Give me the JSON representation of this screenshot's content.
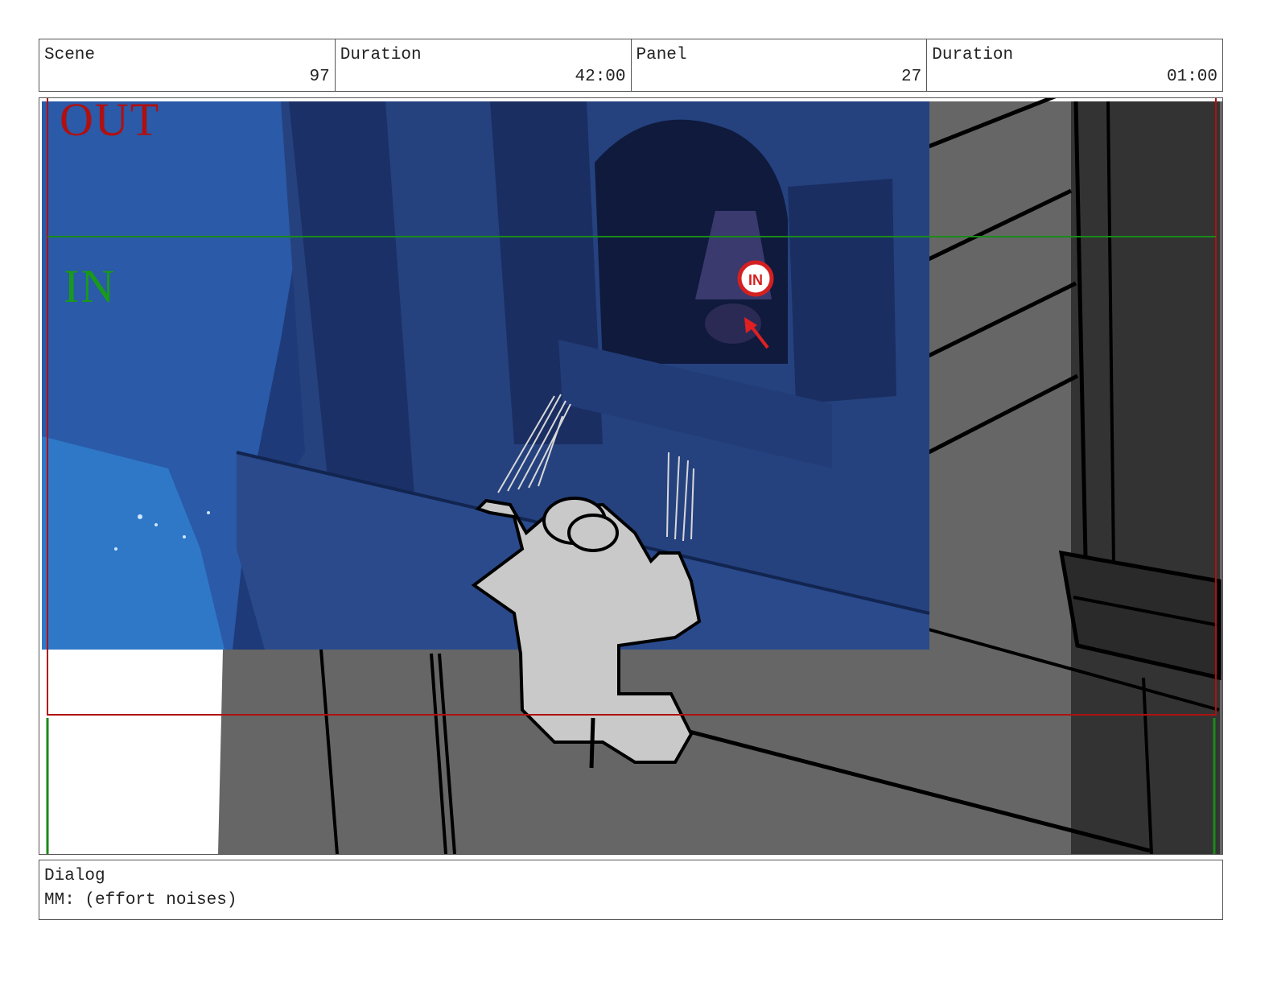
{
  "header": {
    "scene_label": "Scene",
    "scene_value": "97",
    "scene_duration_label": "Duration",
    "scene_duration_value": "42:00",
    "panel_label": "Panel",
    "panel_value": "27",
    "panel_duration_label": "Duration",
    "panel_duration_value": "01:00"
  },
  "panel": {
    "frame_out_label": "OUT",
    "frame_in_label": "IN",
    "sign_label": "IN"
  },
  "dialog": {
    "label": "Dialog",
    "text": "MM: (effort noises)"
  },
  "colors": {
    "out_frame": "#b01010",
    "in_frame": "#1a9a1a",
    "background_blue": "#1e3a78",
    "wall_gray": "#666666"
  }
}
